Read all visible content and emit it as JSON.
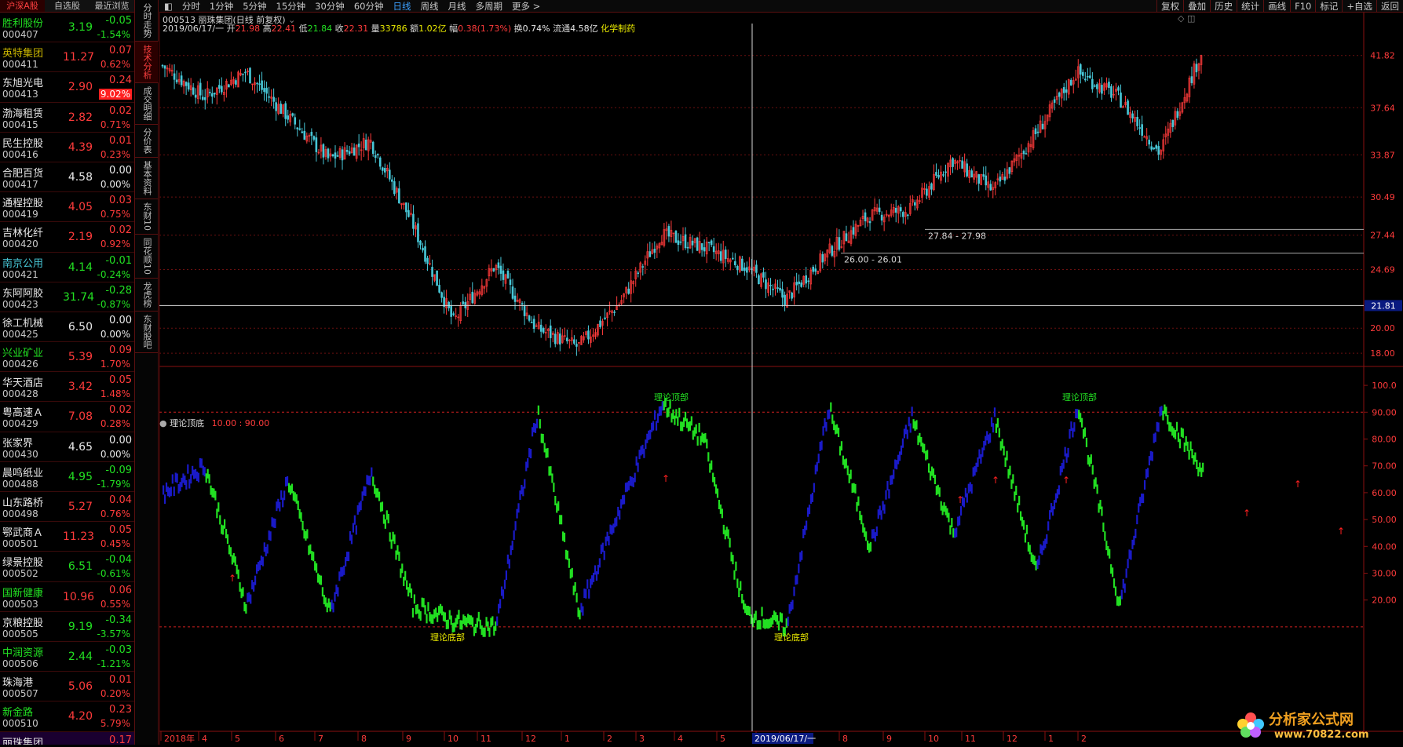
{
  "list_tabs": [
    "沪深A股",
    "自选股",
    "最近浏览"
  ],
  "stocks": [
    {
      "name": "胜利股份",
      "code": "000407",
      "price": "3.19",
      "chg": "-0.05",
      "pct": "-1.54%",
      "dir": "dn",
      "nc": "dn"
    },
    {
      "name": "英特集团",
      "code": "000411",
      "price": "11.27",
      "chg": "0.07",
      "pct": "0.62%",
      "dir": "up",
      "nc": "yl"
    },
    {
      "name": "东旭光电",
      "code": "000413",
      "price": "2.90",
      "chg": "0.24",
      "pct": "9.02%",
      "dir": "up",
      "nc": "wh",
      "hl": true
    },
    {
      "name": "渤海租赁",
      "code": "000415",
      "price": "2.82",
      "chg": "0.02",
      "pct": "0.71%",
      "dir": "up",
      "nc": "wh"
    },
    {
      "name": "民生控股",
      "code": "000416",
      "price": "4.39",
      "chg": "0.01",
      "pct": "0.23%",
      "dir": "up",
      "nc": "wh"
    },
    {
      "name": "合肥百货",
      "code": "000417",
      "price": "4.58",
      "chg": "0.00",
      "pct": "0.00%",
      "dir": "fl",
      "nc": "wh"
    },
    {
      "name": "通程控股",
      "code": "000419",
      "price": "4.05",
      "chg": "0.03",
      "pct": "0.75%",
      "dir": "up",
      "nc": "wh"
    },
    {
      "name": "吉林化纤",
      "code": "000420",
      "price": "2.19",
      "chg": "0.02",
      "pct": "0.92%",
      "dir": "up",
      "nc": "wh"
    },
    {
      "name": "南京公用",
      "code": "000421",
      "price": "4.14",
      "chg": "-0.01",
      "pct": "-0.24%",
      "dir": "dn",
      "nc": "cy"
    },
    {
      "name": "东阿阿胶",
      "code": "000423",
      "price": "31.74",
      "chg": "-0.28",
      "pct": "-0.87%",
      "dir": "dn",
      "nc": "wh"
    },
    {
      "name": "徐工机械",
      "code": "000425",
      "price": "6.50",
      "chg": "0.00",
      "pct": "0.00%",
      "dir": "fl",
      "nc": "wh"
    },
    {
      "name": "兴业矿业",
      "code": "000426",
      "price": "5.39",
      "chg": "0.09",
      "pct": "1.70%",
      "dir": "up",
      "nc": "gr"
    },
    {
      "name": "华天酒店",
      "code": "000428",
      "price": "3.42",
      "chg": "0.05",
      "pct": "1.48%",
      "dir": "up",
      "nc": "wh"
    },
    {
      "name": "粤高速Ａ",
      "code": "000429",
      "price": "7.08",
      "chg": "0.02",
      "pct": "0.28%",
      "dir": "up",
      "nc": "wh"
    },
    {
      "name": "张家界",
      "code": "000430",
      "price": "4.65",
      "chg": "0.00",
      "pct": "0.00%",
      "dir": "fl",
      "nc": "wh"
    },
    {
      "name": "晨鸣纸业",
      "code": "000488",
      "price": "4.95",
      "chg": "-0.09",
      "pct": "-1.79%",
      "dir": "dn",
      "nc": "wh"
    },
    {
      "name": "山东路桥",
      "code": "000498",
      "price": "5.27",
      "chg": "0.04",
      "pct": "0.76%",
      "dir": "up",
      "nc": "wh"
    },
    {
      "name": "鄂武商Ａ",
      "code": "000501",
      "price": "11.23",
      "chg": "0.05",
      "pct": "0.45%",
      "dir": "up",
      "nc": "wh"
    },
    {
      "name": "绿景控股",
      "code": "000502",
      "price": "6.51",
      "chg": "-0.04",
      "pct": "-0.61%",
      "dir": "dn",
      "nc": "wh"
    },
    {
      "name": "国新健康",
      "code": "000503",
      "price": "10.96",
      "chg": "0.06",
      "pct": "0.55%",
      "dir": "up",
      "nc": "gr"
    },
    {
      "name": "京粮控股",
      "code": "000505",
      "price": "9.19",
      "chg": "-0.34",
      "pct": "-3.57%",
      "dir": "dn",
      "nc": "wh"
    },
    {
      "name": "中润资源",
      "code": "000506",
      "price": "2.44",
      "chg": "-0.03",
      "pct": "-1.21%",
      "dir": "dn",
      "nc": "gr"
    },
    {
      "name": "珠海港",
      "code": "000507",
      "price": "5.06",
      "chg": "0.01",
      "pct": "0.20%",
      "dir": "up",
      "nc": "wh"
    },
    {
      "name": "新金路",
      "code": "000510",
      "price": "4.20",
      "chg": "0.23",
      "pct": "5.79%",
      "dir": "up",
      "nc": "gr"
    },
    {
      "name": "丽珠集团",
      "code": "",
      "price": "",
      "chg": "0.17",
      "pct": "",
      "dir": "up",
      "nc": "wh",
      "sel": true
    }
  ],
  "vertical_tabs": [
    "分时走势",
    "技术分析",
    "成交明细",
    "分价表",
    "基本资料",
    "东财10",
    "同花顺10",
    "龙虎榜",
    "东财股吧"
  ],
  "active_vtab": "技术分析",
  "toolbar": {
    "periods": [
      "分时",
      "1分钟",
      "5分钟",
      "15分钟",
      "30分钟",
      "60分钟",
      "日线",
      "周线",
      "月线",
      "多周期",
      "更多 >"
    ],
    "active": "日线",
    "right": [
      "复权",
      "叠加",
      "历史",
      "统计",
      "画线",
      "F10",
      "标记",
      "+自选",
      "返回"
    ]
  },
  "chart_title": "000513 丽珠集团(日线 前复权)",
  "info": {
    "date": "2019/06/17/一",
    "open_l": "开",
    "open": "21.98",
    "high_l": "高",
    "high": "22.41",
    "low_l": "低",
    "low": "21.84",
    "close_l": "收",
    "close": "22.31",
    "vol_l": "量",
    "vol": "33786",
    "amt_l": "额",
    "amt": "1.02亿",
    "amp_l": "幅",
    "amp": "0.38(1.73%)",
    "turn_l": "换",
    "turn": "0.74%",
    "float_l": "流通",
    "float": "4.58亿",
    "industry": "化学制药"
  },
  "price_axis": [
    "41.82",
    "37.64",
    "33.87",
    "30.49",
    "27.44",
    "24.69",
    "20.00",
    "18.00"
  ],
  "cursor_price": "21.81",
  "ranges": [
    "27.84 - 27.98",
    "26.00 - 26.01"
  ],
  "indicator": {
    "name": "理论顶底",
    "params": "10.00 : 90.00",
    "axis": [
      "100.0",
      "90.00",
      "80.00",
      "70.00",
      "60.00",
      "50.00",
      "40.00",
      "30.00",
      "20.00"
    ],
    "top_label": "理论顶部",
    "bottom_label": "理论底部"
  },
  "date_axis": [
    "2018年",
    "4",
    "5",
    "6",
    "7",
    "8",
    "9",
    "10",
    "11",
    "12",
    "1",
    "2",
    "3",
    "4",
    "5",
    "6",
    "7",
    "8",
    "9",
    "10",
    "11",
    "12",
    "1",
    "2"
  ],
  "cursor_date": "2019/06/17/一",
  "watermark": {
    "brand": "分析家公式网",
    "url": "www.70822.com"
  },
  "colors": {
    "up": "#ff3b3b",
    "down": "#22e022",
    "cyan": "#48c8d8",
    "blue": "#1a1ac8",
    "grid": "#6a1010",
    "accent": "#3ca0ff"
  },
  "chart_data": [
    {
      "type": "candlestick",
      "title": "000513 丽珠集团(日线 前复权)",
      "y_ticks": [
        41.82,
        37.64,
        33.87,
        30.49,
        27.44,
        24.69,
        20.0,
        18.0
      ],
      "ylim": [
        17,
        44
      ],
      "series": [
        {
          "name": "K线",
          "close_path": [
            {
              "x": "2018-03",
              "y": 41.0
            },
            {
              "x": "2018-04",
              "y": 38.5
            },
            {
              "x": "2018-05",
              "y": 40.5
            },
            {
              "x": "2018-06",
              "y": 37.0
            },
            {
              "x": "2018-07",
              "y": 33.5
            },
            {
              "x": "2018-08",
              "y": 35.0
            },
            {
              "x": "2018-09",
              "y": 28.5
            },
            {
              "x": "2018-10",
              "y": 20.5
            },
            {
              "x": "2018-11",
              "y": 25.0
            },
            {
              "x": "2018-12",
              "y": 20.0
            },
            {
              "x": "2019-01",
              "y": 18.5
            },
            {
              "x": "2019-02",
              "y": 22.0
            },
            {
              "x": "2019-03",
              "y": 27.5
            },
            {
              "x": "2019-04",
              "y": 26.5
            },
            {
              "x": "2019-05",
              "y": 25.0
            },
            {
              "x": "2019-06",
              "y": 22.3
            },
            {
              "x": "2019-07",
              "y": 26.0
            },
            {
              "x": "2019-08",
              "y": 29.0
            },
            {
              "x": "2019-09",
              "y": 29.5
            },
            {
              "x": "2019-10",
              "y": 33.5
            },
            {
              "x": "2019-11",
              "y": 31.0
            },
            {
              "x": "2019-12",
              "y": 35.5
            },
            {
              "x": "2020-01",
              "y": 40.5
            },
            {
              "x": "2020-02",
              "y": 38.5
            },
            {
              "x": "2020-03",
              "y": 34.0
            },
            {
              "x": "2020-04",
              "y": 42.0
            }
          ]
        }
      ]
    },
    {
      "type": "line",
      "title": "理论顶底",
      "y_ticks": [
        100,
        90,
        80,
        70,
        60,
        50,
        40,
        30,
        20
      ],
      "ylim": [
        5,
        105
      ],
      "reference_lines": [
        90,
        10
      ],
      "series": [
        {
          "name": "理论顶底",
          "values": [
            {
              "x": "2018-03",
              "y": 60
            },
            {
              "x": "2018-04",
              "y": 70
            },
            {
              "x": "2018-05",
              "y": 18
            },
            {
              "x": "2018-06",
              "y": 65
            },
            {
              "x": "2018-07",
              "y": 15
            },
            {
              "x": "2018-08",
              "y": 68
            },
            {
              "x": "2018-09",
              "y": 18
            },
            {
              "x": "2018-10",
              "y": 12
            },
            {
              "x": "2018-11",
              "y": 10
            },
            {
              "x": "2018-12",
              "y": 90
            },
            {
              "x": "2019-01",
              "y": 15
            },
            {
              "x": "2019-02",
              "y": 55
            },
            {
              "x": "2019-03",
              "y": 93
            },
            {
              "x": "2019-04",
              "y": 80
            },
            {
              "x": "2019-05",
              "y": 15
            },
            {
              "x": "2019-06",
              "y": 10
            },
            {
              "x": "2019-07",
              "y": 92
            },
            {
              "x": "2019-08",
              "y": 40
            },
            {
              "x": "2019-09",
              "y": 88
            },
            {
              "x": "2019-10",
              "y": 45
            },
            {
              "x": "2019-11",
              "y": 88
            },
            {
              "x": "2019-12",
              "y": 30
            },
            {
              "x": "2020-01",
              "y": 93
            },
            {
              "x": "2020-02",
              "y": 18
            },
            {
              "x": "2020-03",
              "y": 92
            },
            {
              "x": "2020-04",
              "y": 68
            }
          ]
        }
      ],
      "annotations": [
        {
          "text": "理论顶部",
          "x": "2019-03"
        },
        {
          "text": "理论底部",
          "x": "2018-10"
        },
        {
          "text": "理论底部",
          "x": "2019-06"
        },
        {
          "text": "理论顶部",
          "x": "2020-01"
        }
      ]
    }
  ]
}
